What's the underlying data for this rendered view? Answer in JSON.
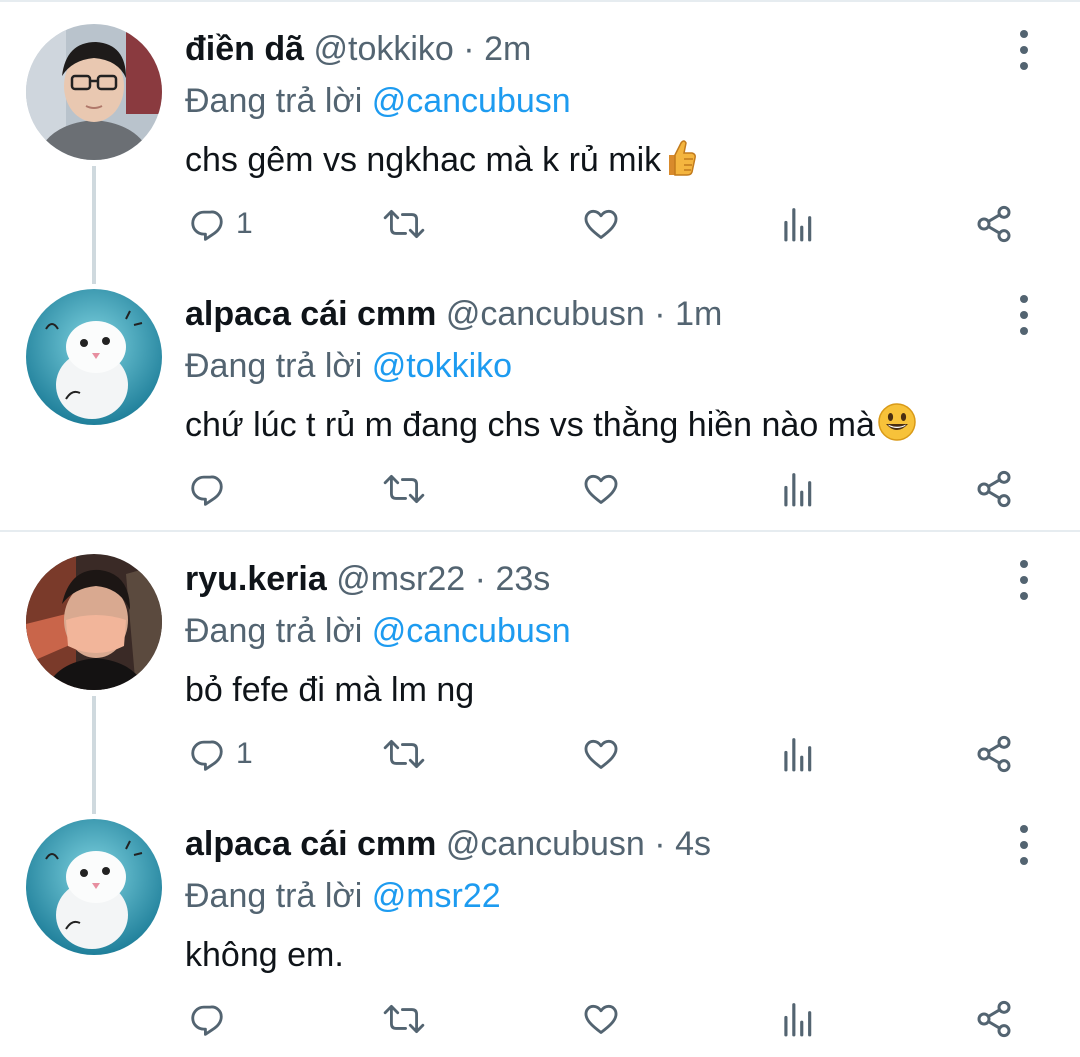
{
  "colors": {
    "accent": "#1d9bf0",
    "secondary_text": "#536471",
    "primary_text": "#0f1419",
    "divider": "#e6ecf0",
    "thread_line": "#cfd9de"
  },
  "tweets": [
    {
      "name": "điền dã",
      "handle": "@tokkiko",
      "separator": "·",
      "time": "2m",
      "reply_prefix": "Đang trả lời",
      "reply_to": "@cancubusn",
      "text": "chs gêm vs ngkhac mà k rủ mik",
      "emoji": "thumbs-up",
      "reply_count": "1",
      "avatar": "young-man-glasses-avatar"
    },
    {
      "name": "alpaca cái cmm",
      "handle": "@cancubusn",
      "separator": "·",
      "time": "1m",
      "reply_prefix": "Đang trả lời",
      "reply_to": "@tokkiko",
      "text": "chứ lúc t rủ m đang chs vs thằng hiền nào mà",
      "emoji": "grinning-face",
      "reply_count": "",
      "avatar": "white-ferret-avatar"
    },
    {
      "name": "ryu.keria",
      "handle": "@msr22",
      "separator": "·",
      "time": "23s",
      "reply_prefix": "Đang trả lời",
      "reply_to": "@cancubusn",
      "text": "bỏ fefe đi mà lm ng",
      "emoji": "",
      "reply_count": "1",
      "avatar": "masked-person-avatar"
    },
    {
      "name": "alpaca cái cmm",
      "handle": "@cancubusn",
      "separator": "·",
      "time": "4s",
      "reply_prefix": "Đang trả lời",
      "reply_to": "@msr22",
      "text": "không em.",
      "emoji": "",
      "reply_count": "",
      "avatar": "white-ferret-avatar"
    }
  ]
}
